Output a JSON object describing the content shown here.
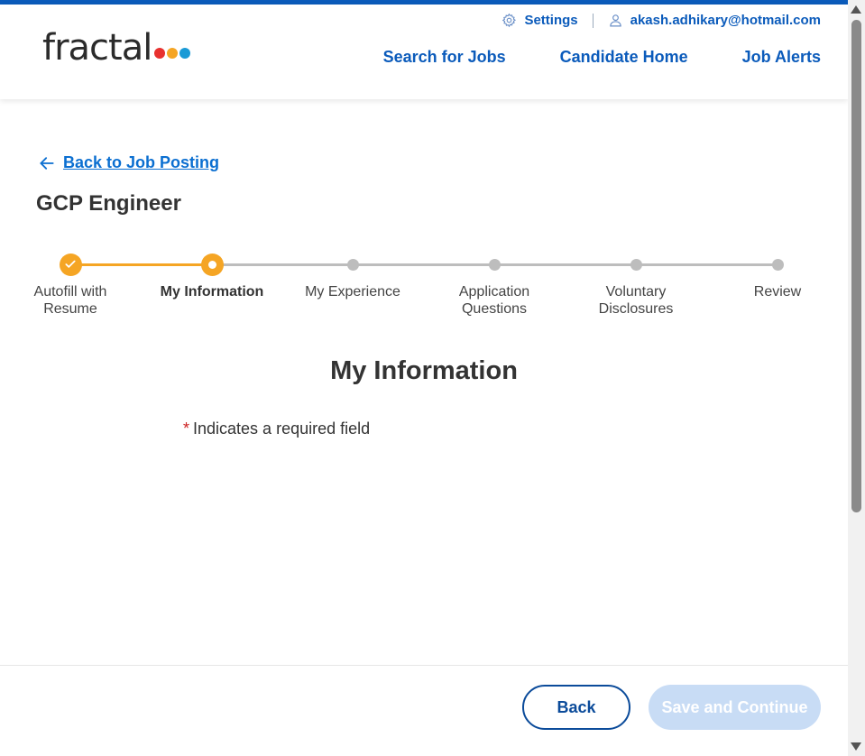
{
  "header": {
    "logo_text": "fractal",
    "logo_dot_colors": [
      "#e8312f",
      "#f5a524",
      "#1a9ad6"
    ],
    "settings_label": "Settings",
    "user_email": "akash.adhikary@hotmail.com",
    "nav": {
      "search_jobs": "Search for Jobs",
      "candidate_home": "Candidate Home",
      "job_alerts": "Job Alerts"
    }
  },
  "page": {
    "back_link": "Back to Job Posting",
    "job_title": "GCP Engineer",
    "section_title": "My Information",
    "required_star": "*",
    "required_note": "Indicates a required field"
  },
  "steps": [
    {
      "label": "Autofill with Resume",
      "state": "done"
    },
    {
      "label": "My Information",
      "state": "current"
    },
    {
      "label": "My Experience",
      "state": "todo"
    },
    {
      "label": "Application Questions",
      "state": "todo"
    },
    {
      "label": "Voluntary Disclosures",
      "state": "todo"
    },
    {
      "label": "Review",
      "state": "todo"
    }
  ],
  "footer": {
    "back_button": "Back",
    "save_button": "Save and Continue",
    "save_enabled": false
  },
  "colors": {
    "brand_blue": "#0b5bbb",
    "step_accent": "#f5a524",
    "step_inactive": "#bdbdbd",
    "required_red": "#cc2222"
  }
}
